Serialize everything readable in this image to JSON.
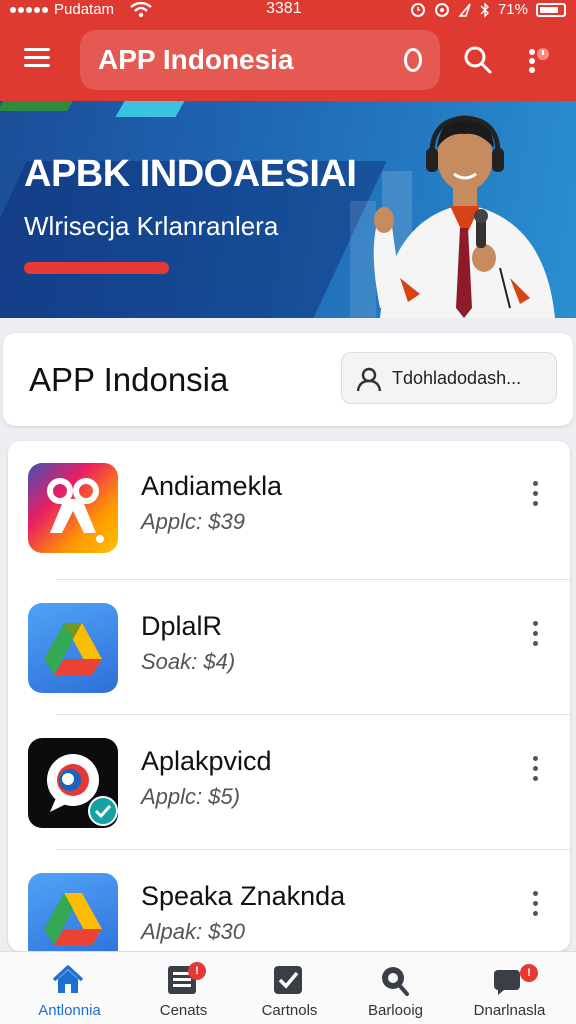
{
  "status_bar": {
    "carrier": "Pudatam",
    "time": "3381",
    "battery": "71%"
  },
  "app_bar": {
    "title": "APP Indonesia"
  },
  "banner": {
    "headline": "APBK INDOAESIAI",
    "subline": "Wlrisecja Krlanranlera"
  },
  "header": {
    "title": "APP Indonsia",
    "button_label": "Tdohladodash..."
  },
  "apps": [
    {
      "name": "Andiamekla",
      "price": "Applc: $39",
      "icon": "scissors-app-icon"
    },
    {
      "name": "DplalR",
      "price": "Soak: $4)",
      "icon": "drive-app-icon"
    },
    {
      "name": "Aplakpvicd",
      "price": "Applc: $5)",
      "icon": "chat-bubble-app-icon"
    },
    {
      "name": "Speaka Znaknda",
      "price": "Alpak: $30",
      "icon": "drive-app-icon"
    }
  ],
  "bottom_nav": [
    {
      "label": "Antlonnia",
      "icon": "home-icon",
      "active": true,
      "badge": ""
    },
    {
      "label": "Cenats",
      "icon": "list-icon",
      "active": false,
      "badge": "!"
    },
    {
      "label": "Cartnols",
      "icon": "check-box-icon",
      "active": false,
      "badge": ""
    },
    {
      "label": "Barlooig",
      "icon": "search-icon",
      "active": false,
      "badge": ""
    },
    {
      "label": "Dnarlnasla",
      "icon": "message-icon",
      "active": false,
      "badge": "!"
    }
  ],
  "colors": {
    "app_bar": "#df3a32",
    "banner": "#1f68b5",
    "active_tab": "#1e6fd0",
    "badge": "#e53935"
  }
}
